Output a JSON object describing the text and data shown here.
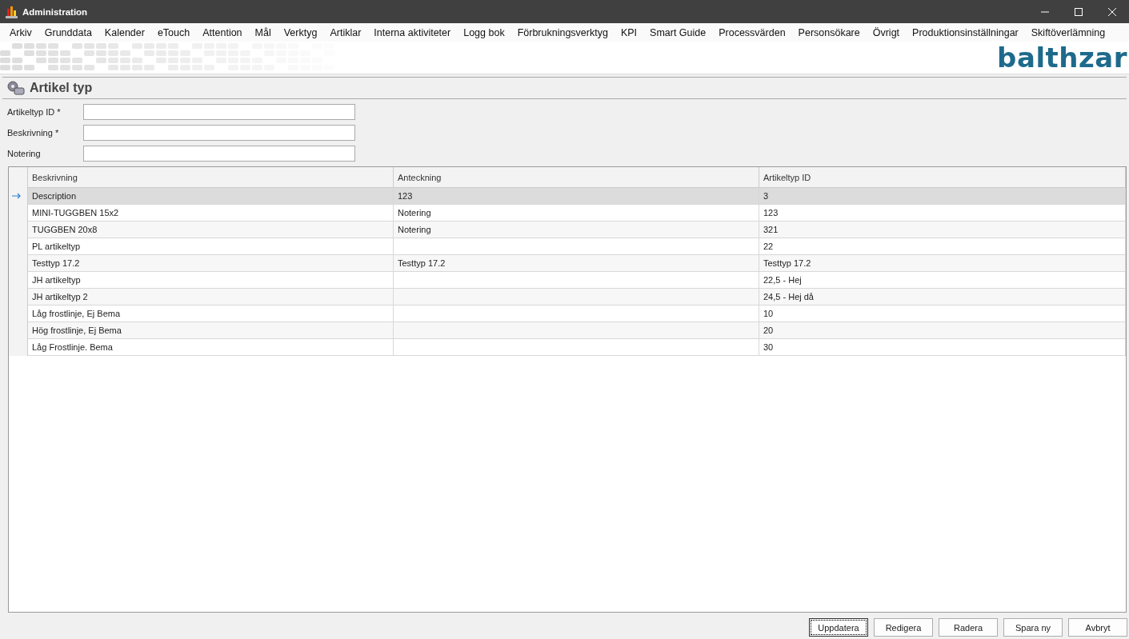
{
  "window": {
    "title": "Administration"
  },
  "menu": [
    "Arkiv",
    "Grunddata",
    "Kalender",
    "eTouch",
    "Attention",
    "Mål",
    "Verktyg",
    "Artiklar",
    "Interna aktiviteter",
    "Logg bok",
    "Förbrukningsverktyg",
    "KPI",
    "Smart Guide",
    "Processvärden",
    "Personsökare",
    "Övrigt",
    "Produktionsinställningar",
    "Skiftöverlämning"
  ],
  "logo": "balthzar",
  "panel": {
    "title": "Artikel typ"
  },
  "form": [
    {
      "label": "Artikeltyp ID *"
    },
    {
      "label": "Beskrivning *"
    },
    {
      "label": "Notering"
    }
  ],
  "table": {
    "columns": [
      "Beskrivning",
      "Anteckning",
      "Artikeltyp ID"
    ],
    "rows": [
      {
        "cells": [
          "Description",
          "123",
          "3"
        ],
        "selected": true
      },
      {
        "cells": [
          "MINI-TUGGBEN 15x2",
          "Notering",
          "123"
        ],
        "selected": false
      },
      {
        "cells": [
          "TUGGBEN 20x8",
          "Notering",
          "321"
        ],
        "selected": false
      },
      {
        "cells": [
          "PL artikeltyp",
          "",
          "22"
        ],
        "selected": false
      },
      {
        "cells": [
          "Testtyp 17.2",
          "Testtyp 17.2",
          "Testtyp 17.2"
        ],
        "selected": false
      },
      {
        "cells": [
          "JH artikeltyp",
          "",
          "22,5 - Hej"
        ],
        "selected": false
      },
      {
        "cells": [
          "JH artikeltyp 2",
          "",
          "24,5 - Hej då"
        ],
        "selected": false
      },
      {
        "cells": [
          "Låg frostlinje, Ej Bema",
          "",
          "10"
        ],
        "selected": false
      },
      {
        "cells": [
          "Hög frostlinje, Ej Bema",
          "",
          "20"
        ],
        "selected": false
      },
      {
        "cells": [
          "Låg Frostlinje. Bema",
          "",
          "30"
        ],
        "selected": false
      }
    ]
  },
  "buttons": [
    {
      "label": "Uppdatera",
      "focused": true
    },
    {
      "label": "Redigera",
      "focused": false
    },
    {
      "label": "Radera",
      "focused": false
    },
    {
      "label": "Spara ny",
      "focused": false
    },
    {
      "label": "Avbryt",
      "focused": false
    }
  ]
}
